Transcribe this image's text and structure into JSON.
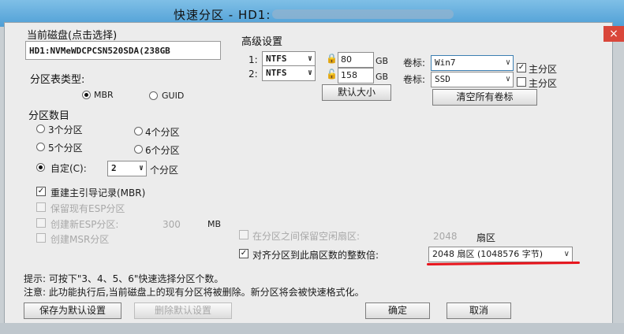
{
  "window": {
    "title": "快速分区 - HD1:",
    "close": "×"
  },
  "disk": {
    "group_label": "当前磁盘(点击选择)",
    "name": "HD1:NVMeWDCPCSN520SDA(238GB"
  },
  "table_type": {
    "label": "分区表类型:",
    "options": [
      "MBR",
      "GUID"
    ],
    "selected": "MBR"
  },
  "partition_count": {
    "label": "分区数目",
    "options": [
      "3个分区",
      "4个分区",
      "5个分区",
      "6个分区"
    ],
    "custom_label": "自定(C):",
    "custom_value": "2",
    "custom_suffix": "个分区"
  },
  "options": {
    "rebuild_mbr": "重建主引导记录(MBR)",
    "keep_esp": "保留现有ESP分区",
    "create_esp": "创建新ESP分区:",
    "esp_size": "300",
    "esp_unit": "MB",
    "create_msr": "创建MSR分区"
  },
  "advanced": {
    "label": "高级设置",
    "rows": [
      {
        "index": "1:",
        "fs": "NTFS",
        "size": "80",
        "unit": "GB",
        "volume_label": "卷标:",
        "volume": "Win7",
        "primary": "主分区",
        "primary_checked": true
      },
      {
        "index": "2:",
        "fs": "NTFS",
        "size": "158",
        "unit": "GB",
        "volume_label": "卷标:",
        "volume": "SSD",
        "primary": "主分区",
        "primary_checked": false
      }
    ],
    "default_size_button": "默认大小",
    "clear_labels_button": "清空所有卷标"
  },
  "align": {
    "keep_free_label": "在分区之间保留空闲扇区:",
    "keep_free_value": "2048",
    "keep_free_unit": "扇区",
    "align_label": "对齐分区到此扇区数的整数倍:",
    "align_value": "2048 扇区 (1048576 字节)"
  },
  "tips": {
    "line1": "提示: 可按下\"3、4、5、6\"快速选择分区个数。",
    "line2": "注意: 此功能执行后,当前磁盘上的现有分区将被删除。新分区将会被快速格式化。"
  },
  "buttons": {
    "save_default": "保存为默认设置",
    "delete_default": "删除默认设置",
    "ok": "确定",
    "cancel": "取消"
  },
  "colors": {
    "titlebar": "#4f9fd6",
    "close": "#d9463a",
    "annotation": "#e8141c"
  }
}
